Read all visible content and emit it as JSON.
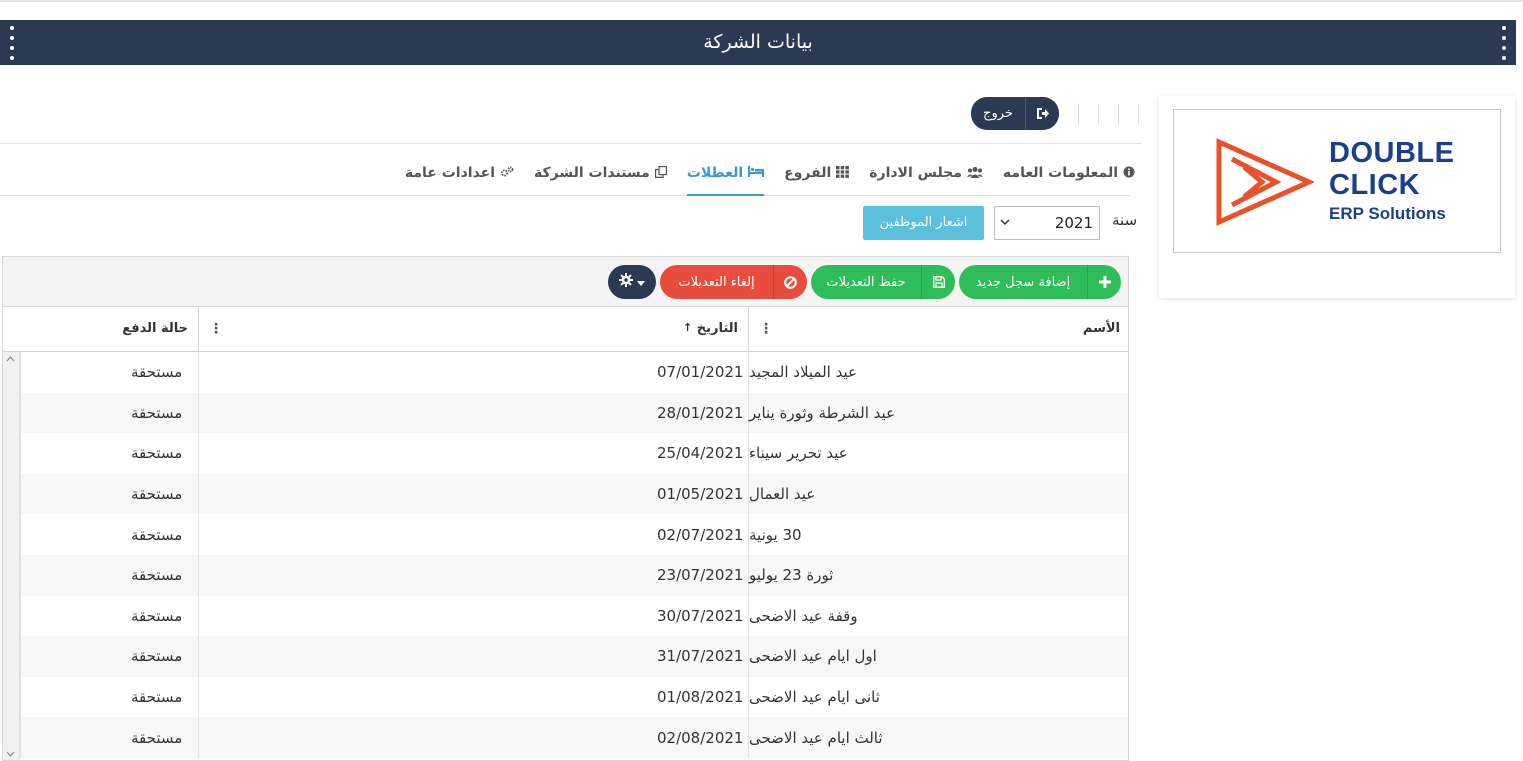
{
  "header": {
    "title": "بيانات الشركة"
  },
  "logo": {
    "line1": "DOUBLE",
    "line2": "CLICK",
    "line3": "ERP Solutions",
    "brand_color": "#1d3f8a",
    "mark_color": "#e8512a"
  },
  "topbar": {
    "exit_label": "خروج"
  },
  "tabs": [
    {
      "label": "المعلومات العامه",
      "icon": "info-icon"
    },
    {
      "label": "مجلس الادارة",
      "icon": "users-icon"
    },
    {
      "label": "الفروع",
      "icon": "grid-icon"
    },
    {
      "label": "العطلات",
      "icon": "bed-icon",
      "active": true
    },
    {
      "label": "مستندات الشركة",
      "icon": "copy-icon"
    },
    {
      "label": "اعدادات عامة",
      "icon": "gears-icon"
    }
  ],
  "filters": {
    "year_label": "سنة",
    "year_value": "2021",
    "notify_label": "اشعار الموظفين"
  },
  "toolbar": {
    "add_label": "إضافة سجل جديد",
    "save_label": "حفظ التعديلات",
    "cancel_label": "إلغاء التعديلات"
  },
  "columns": {
    "name": "الأسم",
    "date": "التاريخ",
    "status": "حالة الدفع"
  },
  "rows": [
    {
      "name": "عيد الميلاد المجيد",
      "date": "07/01/2021",
      "status": "مستحقة"
    },
    {
      "name": "عيد الشرطة وثورة يناير",
      "date": "28/01/2021",
      "status": "مستحقة"
    },
    {
      "name": "عيد تحرير سيناء",
      "date": "25/04/2021",
      "status": "مستحقة"
    },
    {
      "name": "عيد العمال",
      "date": "01/05/2021",
      "status": "مستحقة"
    },
    {
      "name": "30 يونية",
      "date": "02/07/2021",
      "status": "مستحقة"
    },
    {
      "name": "ثورة 23 يوليو",
      "date": "23/07/2021",
      "status": "مستحقة"
    },
    {
      "name": "وقفة عيد الاضحى",
      "date": "30/07/2021",
      "status": "مستحقة"
    },
    {
      "name": "اول ايام عيد الاضحى",
      "date": "31/07/2021",
      "status": "مستحقة"
    },
    {
      "name": "ثانى ايام عيد الاضحى",
      "date": "01/08/2021",
      "status": "مستحقة"
    },
    {
      "name": "ثالث ايام عيد الاضحى",
      "date": "02/08/2021",
      "status": "مستحقة"
    }
  ]
}
